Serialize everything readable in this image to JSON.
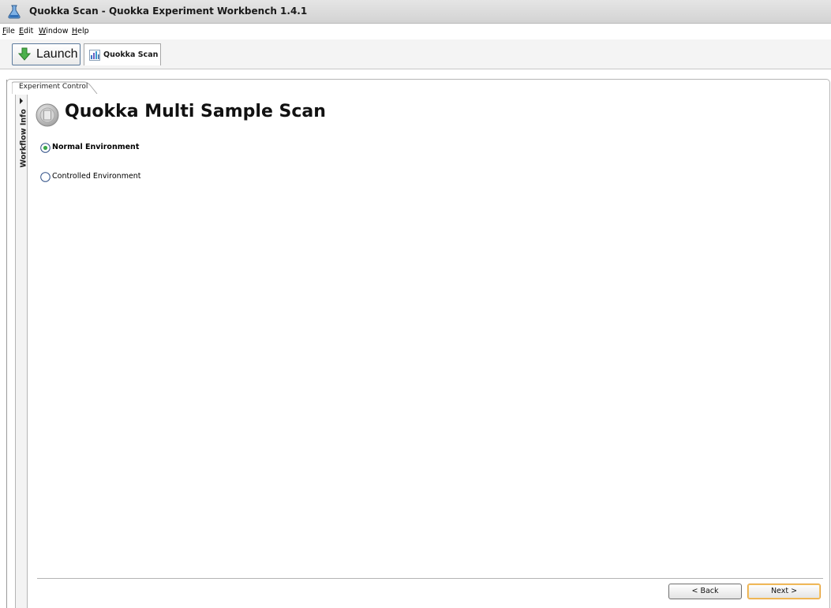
{
  "window": {
    "title": "Quokka Scan - Quokka Experiment Workbench 1.4.1"
  },
  "menubar": {
    "items": [
      {
        "pre": "",
        "accel": "F",
        "post": "ile"
      },
      {
        "pre": "",
        "accel": "E",
        "post": "dit"
      },
      {
        "pre": "",
        "accel": "W",
        "post": "indow"
      },
      {
        "pre": "",
        "accel": "H",
        "post": "elp"
      }
    ]
  },
  "toolbar": {
    "launch_label": "Launch",
    "perspective_tab_label": "Quokka Scan"
  },
  "editor": {
    "tab_label": "Experiment Control",
    "side_panel_label": "Workflow Info",
    "page_title": "Quokka Multi Sample Scan",
    "options": [
      {
        "label": "Normal Environment",
        "selected": true
      },
      {
        "label": "Controlled Environment",
        "selected": false
      }
    ]
  },
  "footer": {
    "back_label": "< Back",
    "next_label": "Next >"
  },
  "colors": {
    "titlebar_bg": "#d3d3d3",
    "launch_arrow": "#3ea33e",
    "next_button_border": "#e6a23a"
  },
  "icons": {
    "app": "flask-icon",
    "launch": "green-down-arrow-icon",
    "perspective": "scan-chart-icon",
    "heading": "disc-icon"
  }
}
